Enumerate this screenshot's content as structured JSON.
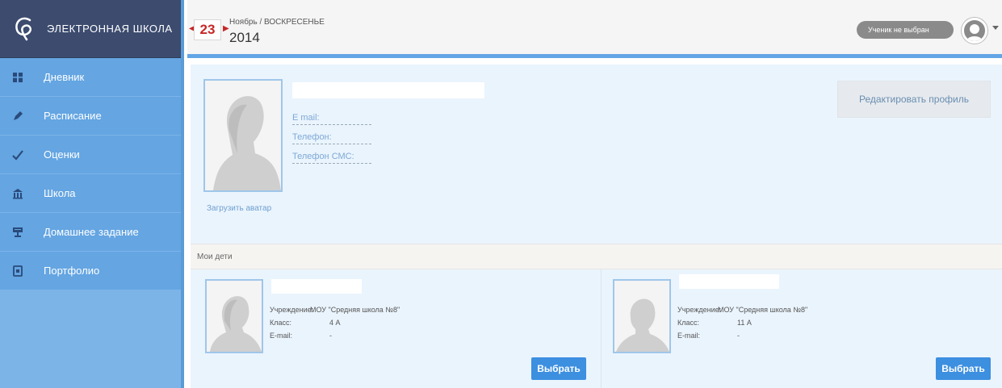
{
  "sidebar": {
    "logo_text": "ЭЛЕКТРОННАЯ ШКОЛА",
    "items": [
      {
        "label": "Дневник",
        "icon": "book-icon"
      },
      {
        "label": "Расписание",
        "icon": "pen-icon"
      },
      {
        "label": "Оценки",
        "icon": "check-icon"
      },
      {
        "label": "Школа",
        "icon": "school-icon"
      },
      {
        "label": "Домашнее задание",
        "icon": "homework-icon"
      },
      {
        "label": "Портфолио",
        "icon": "portfolio-icon"
      }
    ]
  },
  "header": {
    "day": "23",
    "month_weekday": "Ноябрь / ВОСКРЕСЕНЬЕ",
    "year": "2014",
    "student_select": "Ученик не выбран"
  },
  "profile": {
    "email_label": "E mail:",
    "phone_label": "Телефон:",
    "sms_phone_label": "Телефон СМС:",
    "upload_avatar": "Загрузить аватар",
    "edit_profile": "Редактировать профиль"
  },
  "children": {
    "title": "Мои дети",
    "cards": [
      {
        "institution_label": "Учреждение:",
        "institution_value": "МОУ \"Средняя школа №8\"",
        "class_label": "Класс:",
        "class_value": "4 А",
        "email_label": "E-mail:",
        "email_value": "-",
        "select_label": "Выбрать"
      },
      {
        "institution_label": "Учреждение:",
        "institution_value": "МОУ \"Средняя школа №8\"",
        "class_label": "Класс:",
        "class_value": "11 А",
        "email_label": "E-mail:",
        "email_value": "-",
        "select_label": "Выбрать"
      }
    ]
  },
  "colors": {
    "sidebar": "#64a5e2",
    "logo_bar": "#3c4b6e",
    "accent": "#3d8fe0",
    "date_red": "#c62828"
  }
}
